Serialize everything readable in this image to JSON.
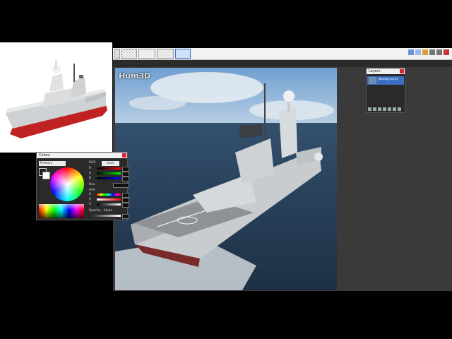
{
  "canvas": {
    "watermark": "Hum3D"
  },
  "colors_panel": {
    "title": "Colors",
    "mode_label": "Primary",
    "more_label": "Less",
    "rgb_label": "RGB",
    "hsv_label": "HSV",
    "hex_label": "Hex",
    "opacity_label": "Opacity - Alpha",
    "channels": [
      "R",
      "G",
      "B"
    ],
    "hsv_channels": [
      "H",
      "S",
      "V"
    ]
  },
  "layers_panel": {
    "title": "Layers",
    "layer_name": "Background"
  }
}
